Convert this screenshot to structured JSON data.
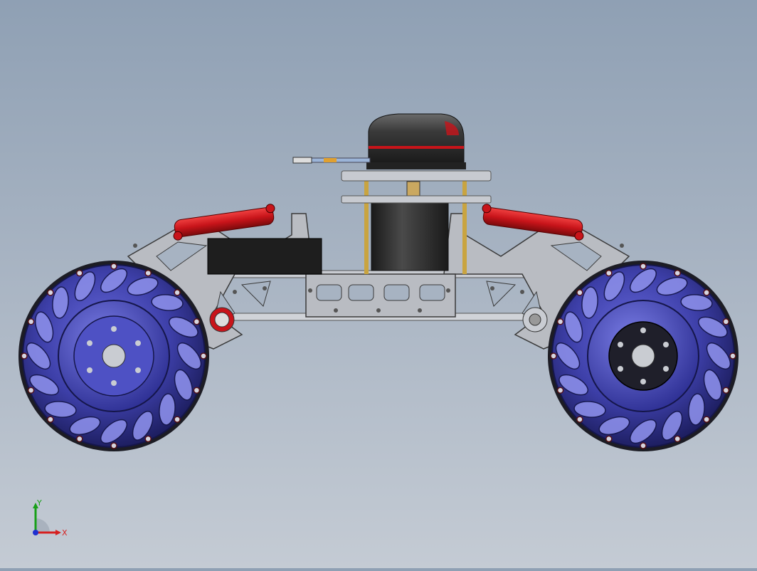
{
  "viewport": {
    "background_top": "#8fa0b4",
    "background_bottom": "#c4cbd4"
  },
  "model": {
    "frame_color": "#b9bcc2",
    "wheel_color": "#3d3fa8",
    "wheel_hub_color": "#1f1f2a",
    "damper_color": "#c8141a",
    "motor_color": "#2a2a2a"
  },
  "triad": {
    "x_label": "X",
    "y_label": "Y",
    "x_color": "#d62020",
    "y_color": "#18a018",
    "z_color": "#2030d0"
  }
}
